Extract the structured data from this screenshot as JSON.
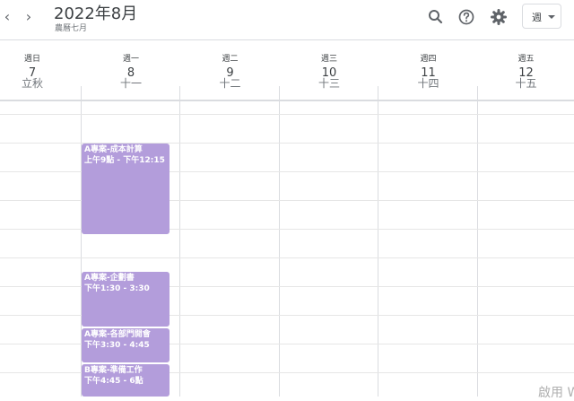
{
  "header": {
    "prev_glyph": "‹",
    "next_glyph": "›",
    "month_title": "2022年8月",
    "lunar_month": "農曆七月",
    "view_label": "週",
    "icons": [
      "search-icon",
      "help-icon",
      "settings-icon",
      "chevron-down-icon"
    ]
  },
  "days": [
    {
      "name": "週日",
      "num": "7",
      "lunar": "立秋"
    },
    {
      "name": "週一",
      "num": "8",
      "lunar": "十一"
    },
    {
      "name": "週二",
      "num": "9",
      "lunar": "十二"
    },
    {
      "name": "週三",
      "num": "10",
      "lunar": "十三"
    },
    {
      "name": "週四",
      "num": "11",
      "lunar": "十四"
    },
    {
      "name": "週五",
      "num": "12",
      "lunar": "十五"
    }
  ],
  "events": [
    {
      "title": "A專案-成本計算",
      "time": "上午9點 - 下午12:15",
      "color": "#b39ddb"
    },
    {
      "title": "A專案-企劃書",
      "time": "下午1:30 - 3:30",
      "color": "#b39ddb"
    },
    {
      "title": "A專案-各部門開會",
      "time": "下午3:30 - 4:45",
      "color": "#b39ddb"
    },
    {
      "title": "B專案-準備工作",
      "time": "下午4:45 - 6點",
      "color": "#b39ddb"
    }
  ],
  "watermark": "啟用 W"
}
